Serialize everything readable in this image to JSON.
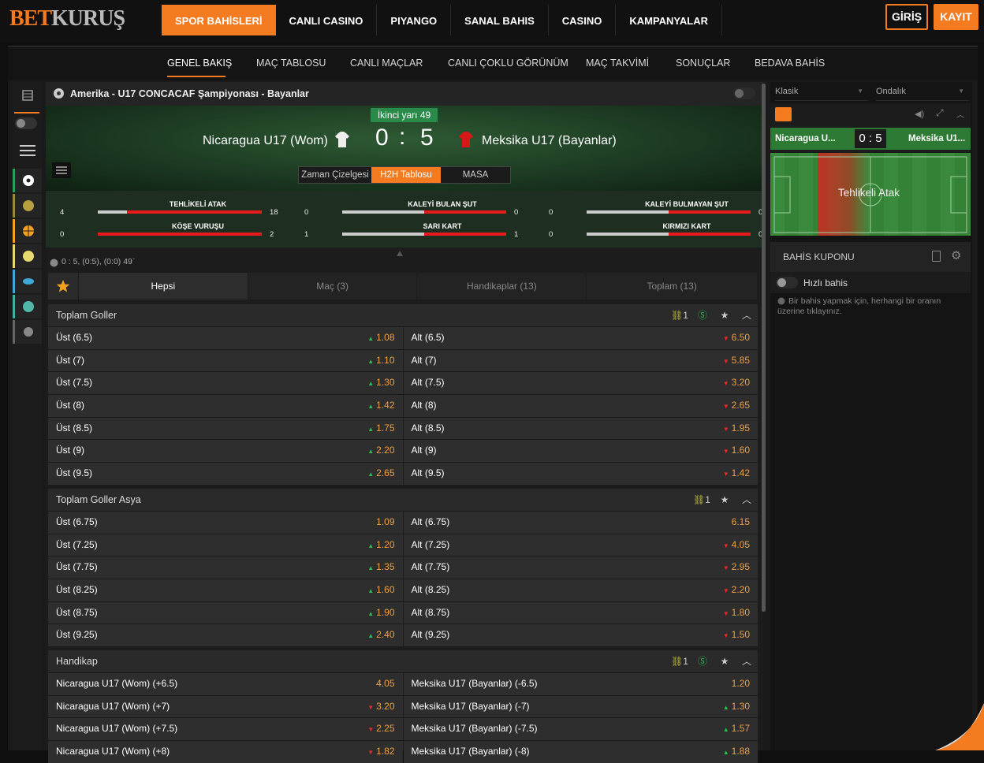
{
  "brand": {
    "part1": "BET",
    "part2": "KURUŞ"
  },
  "nav": [
    "SPOR BAHİSLERİ",
    "CANLI CASINO",
    "PIYANGO",
    "SANAL BAHIS",
    "CASINO",
    "KAMPANYALAR"
  ],
  "auth": {
    "login": "GİRİŞ",
    "register": "KAYIT"
  },
  "subnav": [
    "GENEL BAKIŞ",
    "MAÇ TABLOSU",
    "CANLI MAÇLAR",
    "CANLI ÇOKLU GÖRÜNÜM",
    "MAÇ TAKVİMİ",
    "SONUÇLAR",
    "BEDAVA BAHİS"
  ],
  "event": {
    "title": "Amerika - U17 CONCACAF Şampiyonası - Bayanlar",
    "period": "İkinci yarı 49",
    "home": "Nicaragua U17 (Wom)",
    "away": "Meksika U17 (Bayanlar)",
    "home_score": "0",
    "away_score": "5",
    "separator": ":",
    "tabs": [
      "Zaman Çizelgesi",
      "H2H Tablosu",
      "MASA"
    ],
    "stats": [
      {
        "label": "TEHLİKELİ ATAK",
        "home": "4",
        "away": "18",
        "share": 0.18
      },
      {
        "label": "KALEYİ BULAN ŞUT",
        "home": "0",
        "away": "0",
        "share": 0.5
      },
      {
        "label": "KALEYİ BULMAYAN ŞUT",
        "home": "0",
        "away": "0",
        "share": 0.5
      },
      {
        "label": "KÖŞE VURUŞU",
        "home": "0",
        "away": "2",
        "share": 0.0
      },
      {
        "label": "SARI KART",
        "home": "1",
        "away": "1",
        "share": 0.5
      },
      {
        "label": "KIRMIZI KART",
        "home": "0",
        "away": "0",
        "share": 0.5
      }
    ],
    "info": "0 : 5, (0:5), (0:0) 49`"
  },
  "filters": [
    "Hepsi",
    "Maç (3)",
    "Handikaplar (13)",
    "Toplam (13)"
  ],
  "markets": [
    {
      "name": "Toplam Goller",
      "link_count": "1",
      "rows": [
        [
          "Üst (6.5)",
          "1.08",
          "up",
          "Alt (6.5)",
          "6.50",
          "dn"
        ],
        [
          "Üst (7)",
          "1.10",
          "up",
          "Alt (7)",
          "5.85",
          "dn"
        ],
        [
          "Üst (7.5)",
          "1.30",
          "up",
          "Alt (7.5)",
          "3.20",
          "dn"
        ],
        [
          "Üst (8)",
          "1.42",
          "up",
          "Alt (8)",
          "2.65",
          "dn"
        ],
        [
          "Üst (8.5)",
          "1.75",
          "up",
          "Alt (8.5)",
          "1.95",
          "dn"
        ],
        [
          "Üst (9)",
          "2.20",
          "up",
          "Alt (9)",
          "1.60",
          "dn"
        ],
        [
          "Üst (9.5)",
          "2.65",
          "up",
          "Alt (9.5)",
          "1.42",
          "dn"
        ]
      ]
    },
    {
      "name": "Toplam Goller Asya",
      "link_count": "1",
      "rows": [
        [
          "Üst (6.75)",
          "1.09",
          "",
          "Alt (6.75)",
          "6.15",
          ""
        ],
        [
          "Üst (7.25)",
          "1.20",
          "up",
          "Alt (7.25)",
          "4.05",
          "dn"
        ],
        [
          "Üst (7.75)",
          "1.35",
          "up",
          "Alt (7.75)",
          "2.95",
          "dn"
        ],
        [
          "Üst (8.25)",
          "1.60",
          "up",
          "Alt (8.25)",
          "2.20",
          "dn"
        ],
        [
          "Üst (8.75)",
          "1.90",
          "up",
          "Alt (8.75)",
          "1.80",
          "dn"
        ],
        [
          "Üst (9.25)",
          "2.40",
          "up",
          "Alt (9.25)",
          "1.50",
          "dn"
        ]
      ]
    },
    {
      "name": "Handikap",
      "link_count": "1",
      "rows": [
        [
          "Nicaragua U17 (Wom) (+6.5)",
          "4.05",
          "",
          "Meksika U17 (Bayanlar) (-6.5)",
          "1.20",
          ""
        ],
        [
          "Nicaragua U17 (Wom) (+7)",
          "3.20",
          "dn",
          "Meksika U17 (Bayanlar) (-7)",
          "1.30",
          "up"
        ],
        [
          "Nicaragua U17 (Wom) (+7.5)",
          "2.25",
          "dn",
          "Meksika U17 (Bayanlar) (-7.5)",
          "1.57",
          "up"
        ],
        [
          "Nicaragua U17 (Wom) (+8)",
          "1.82",
          "dn",
          "Meksika U17 (Bayanlar) (-8)",
          "1.88",
          "up"
        ]
      ]
    }
  ],
  "right": {
    "format1": "Klasik",
    "format2": "Ondalık",
    "mini_home": "Nicaragua U...",
    "mini_score": "0 : 5",
    "mini_away": "Meksika U1...",
    "mini_event": "Tehlikeli Atak",
    "coupon_title": "BAHİS KUPONU",
    "quick_bet": "Hızlı bahis",
    "hint": "Bir bahis yapmak için, herhangi bir oranın üzerine tıklayınız."
  },
  "colors": {
    "accent": "#f47b20",
    "up": "#28c050",
    "down": "#e82a2a"
  }
}
